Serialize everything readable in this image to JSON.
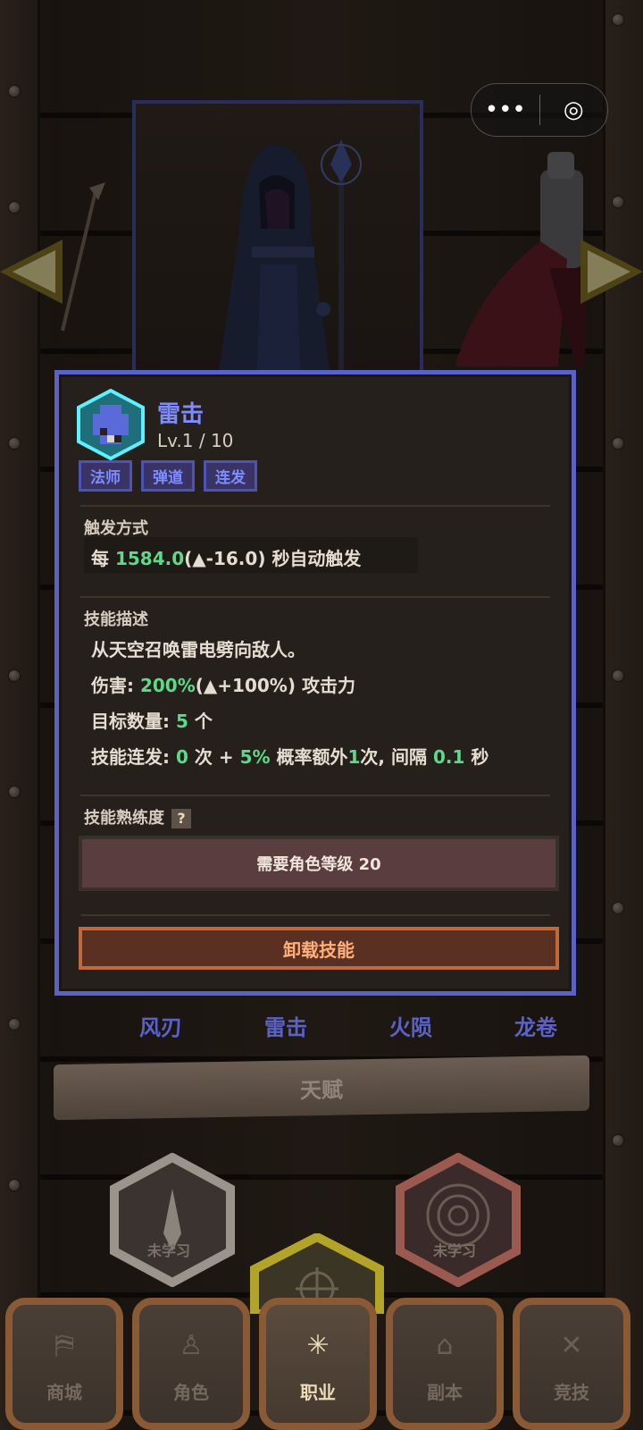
{
  "capsule": {
    "more_icon": "•••",
    "target_icon": "◎"
  },
  "skill": {
    "name": "雷击",
    "level": "Lv.1 / 10",
    "tags": [
      "法师",
      "弹道",
      "连发"
    ],
    "trigger_title": "触发方式",
    "trigger_prefix": "每",
    "trigger_value": "1584.0",
    "trigger_delta": "(▲-16.0)",
    "trigger_suffix": "秒自动触发",
    "desc_title": "技能描述",
    "desc_text": "从天空召唤雷电劈向敌人。",
    "damage_label": "伤害:",
    "damage_value": "200%",
    "damage_delta": "(▲+100%)",
    "damage_suffix": "攻击力",
    "targets_label": "目标数量:",
    "targets_value": "5",
    "targets_suffix": "个",
    "multicast_label": "技能连发:",
    "multicast_count": "0",
    "multicast_mid": "次 +",
    "multicast_chance": "5%",
    "multicast_text": "概率额外",
    "multicast_extra": "1",
    "multicast_text2": "次, 间隔",
    "multicast_interval": "0.1",
    "multicast_unit": "秒",
    "proficiency_title": "技能熟练度",
    "help_icon": "?",
    "requirement": "需要角色等级 20",
    "unload_button": "卸载技能"
  },
  "skill_row": [
    "风刃",
    "雷击",
    "火陨",
    "龙卷"
  ],
  "talent": {
    "banner": "天赋",
    "left_label": "未学习",
    "right_label": "未学习"
  },
  "nav": [
    {
      "label": "商城",
      "icon": "shop-icon",
      "glyph": "⛿"
    },
    {
      "label": "角色",
      "icon": "character-icon",
      "glyph": "♙"
    },
    {
      "label": "职业",
      "icon": "class-icon",
      "glyph": "✳"
    },
    {
      "label": "副本",
      "icon": "dungeon-icon",
      "glyph": "⌂"
    },
    {
      "label": "竞技",
      "icon": "arena-icon",
      "glyph": "✕"
    }
  ],
  "colors": {
    "accent": "#5a62c8",
    "highlight": "#5fd88a",
    "skill_blue": "#7d8cff"
  }
}
